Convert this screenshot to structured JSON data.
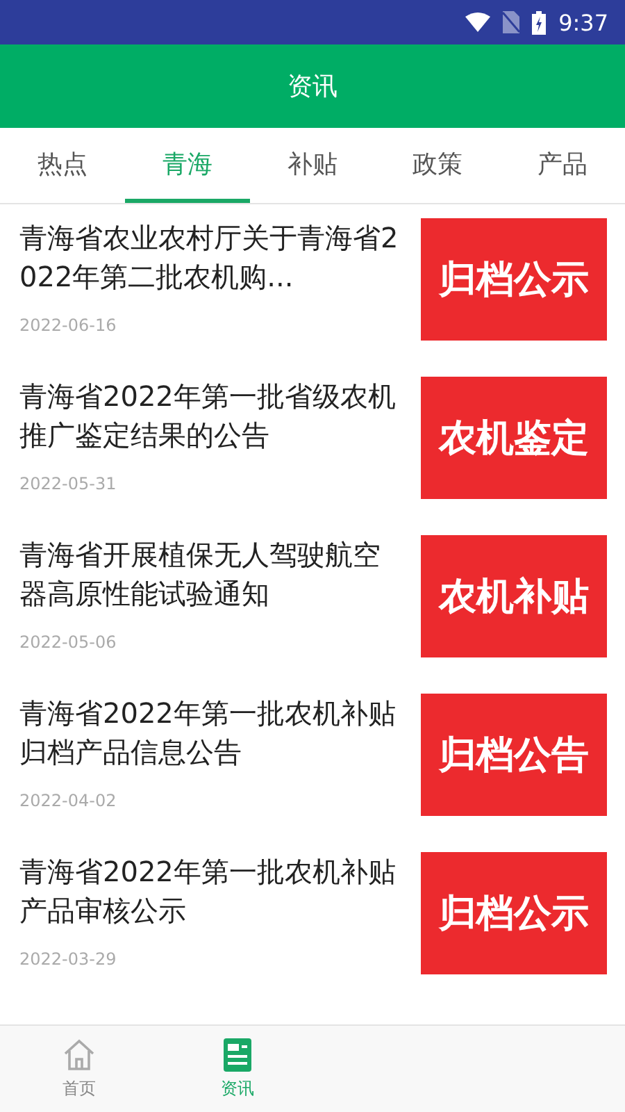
{
  "status_bar": {
    "time": "9:37"
  },
  "header": {
    "title": "资讯"
  },
  "tabs": [
    {
      "label": "热点",
      "selected": false
    },
    {
      "label": "青海",
      "selected": true
    },
    {
      "label": "补贴",
      "selected": false
    },
    {
      "label": "政策",
      "selected": false
    },
    {
      "label": "产品",
      "selected": false
    }
  ],
  "articles": [
    {
      "title": "青海省农业农村厅关于青海省2022年第二批农机购...",
      "date": "2022-06-16",
      "thumbnail": "归档公示"
    },
    {
      "title": "青海省2022年第一批省级农机推广鉴定结果的公告",
      "date": "2022-05-31",
      "thumbnail": "农机鉴定"
    },
    {
      "title": "青海省开展植保无人驾驶航空器高原性能试验通知",
      "date": "2022-05-06",
      "thumbnail": "农机补贴"
    },
    {
      "title": "青海省2022年第一批农机补贴归档产品信息公告",
      "date": "2022-04-02",
      "thumbnail": "归档公告"
    },
    {
      "title": "青海省2022年第一批农机补贴产品审核公示",
      "date": "2022-03-29",
      "thumbnail": "归档公示"
    }
  ],
  "bottom_nav": [
    {
      "label": "首页",
      "kind": "home",
      "selected": false
    },
    {
      "label": "资讯",
      "kind": "news",
      "selected": true
    }
  ]
}
